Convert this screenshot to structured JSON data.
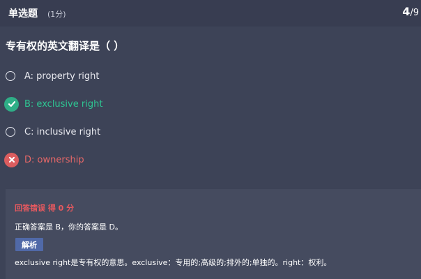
{
  "header": {
    "question_type": "单选题",
    "score": "(1分)",
    "progress_current": "4",
    "progress_total": "/9"
  },
  "question": {
    "text": "专有权的英文翻译是（  ）"
  },
  "options": [
    {
      "label": "A: property right",
      "state": "unselected"
    },
    {
      "label": "B: exclusive right",
      "state": "correct",
      "icon": "check-icon"
    },
    {
      "label": "C: inclusive right",
      "state": "unselected"
    },
    {
      "label": "D: ownership",
      "state": "wrong",
      "icon": "close-icon"
    }
  ],
  "result": {
    "status": "回答错误 得 0 分",
    "answer_text": "正确答案是 B，你的答案是 D。",
    "analysis_label": "解析",
    "analysis_text": "exclusive right是专有权的意思。exclusive：专用的;高级的;排外的;单独的。right：权利。"
  },
  "colors": {
    "background": "#3d4357",
    "correct": "#2ec793",
    "wrong": "#e86868",
    "analysis_button": "#5069a8"
  }
}
